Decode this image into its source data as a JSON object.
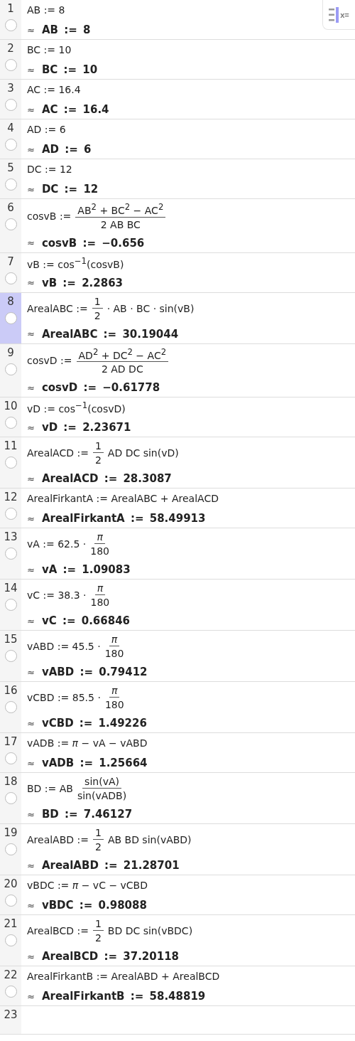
{
  "toggle": {
    "label": "x="
  },
  "rows": [
    {
      "number": "1",
      "selected": false,
      "input": [
        {
          "kind": "text",
          "text": "AB := 8"
        }
      ],
      "approx": "≈",
      "output": "AB := 8"
    },
    {
      "number": "2",
      "selected": false,
      "input": [
        {
          "kind": "text",
          "text": "BC := 10"
        }
      ],
      "approx": "≈",
      "output": "BC := 10"
    },
    {
      "number": "3",
      "selected": false,
      "input": [
        {
          "kind": "text",
          "text": "AC := 16.4"
        }
      ],
      "approx": "≈",
      "output": "AC := 16.4"
    },
    {
      "number": "4",
      "selected": false,
      "input": [
        {
          "kind": "text",
          "text": "AD := 6"
        }
      ],
      "approx": "≈",
      "output": "AD := 6"
    },
    {
      "number": "5",
      "selected": false,
      "input": [
        {
          "kind": "text",
          "text": "DC := 12"
        }
      ],
      "approx": "≈",
      "output": "DC := 12"
    },
    {
      "number": "6",
      "selected": false,
      "input": [
        {
          "kind": "text",
          "text": "cosvB :="
        },
        {
          "kind": "frac",
          "num": "AB$^{2}$ + BC$^{2}$ − AC$^{2}$",
          "den": "2 AB BC"
        }
      ],
      "approx": "≈",
      "output": "cosvB := −0.656"
    },
    {
      "number": "7",
      "selected": false,
      "input": [
        {
          "kind": "text",
          "text": "vB := cos$^{−1}$(cosvB)"
        }
      ],
      "approx": "≈",
      "output": "vB := 2.2863"
    },
    {
      "number": "8",
      "selected": true,
      "input": [
        {
          "kind": "text",
          "text": "ArealABC :="
        },
        {
          "kind": "frac",
          "num": "1",
          "den": "2"
        },
        {
          "kind": "text",
          "text": "·  AB  ·  BC  ·  sin(vB)"
        }
      ],
      "approx": "≈",
      "output": "ArealABC := 30.19044"
    },
    {
      "number": "9",
      "selected": false,
      "input": [
        {
          "kind": "text",
          "text": "cosvD :="
        },
        {
          "kind": "frac",
          "num": "AD$^{2}$ + DC$^{2}$ − AC$^{2}$",
          "den": "2 AD DC"
        }
      ],
      "approx": "≈",
      "output": "cosvD := −0.61778"
    },
    {
      "number": "10",
      "selected": false,
      "input": [
        {
          "kind": "text",
          "text": "vD := cos$^{−1}$(cosvD)"
        }
      ],
      "approx": "≈",
      "output": "vD := 2.23671"
    },
    {
      "number": "11",
      "selected": false,
      "input": [
        {
          "kind": "text",
          "text": "ArealACD :="
        },
        {
          "kind": "frac",
          "num": "1",
          "den": "2"
        },
        {
          "kind": "text",
          "text": "AD DC  sin(vD)"
        }
      ],
      "approx": "≈",
      "output": "ArealACD := 28.3087"
    },
    {
      "number": "12",
      "selected": false,
      "input": [
        {
          "kind": "text",
          "text": "ArealFirkantA := ArealABC + ArealACD"
        }
      ],
      "approx": "≈",
      "output": "ArealFirkantA := 58.49913"
    },
    {
      "number": "13",
      "selected": false,
      "input": [
        {
          "kind": "text",
          "text": "vA := 62.5 ·"
        },
        {
          "kind": "frac",
          "num": "*π*",
          "den": "180"
        }
      ],
      "approx": "≈",
      "output": "vA := 1.09083"
    },
    {
      "number": "14",
      "selected": false,
      "input": [
        {
          "kind": "text",
          "text": "vC := 38.3 ·"
        },
        {
          "kind": "frac",
          "num": "*π*",
          "den": "180"
        }
      ],
      "approx": "≈",
      "output": "vC := 0.66846"
    },
    {
      "number": "15",
      "selected": false,
      "input": [
        {
          "kind": "text",
          "text": "vABD := 45.5 ·"
        },
        {
          "kind": "frac",
          "num": "*π*",
          "den": "180"
        }
      ],
      "approx": "≈",
      "output": "vABD := 0.79412"
    },
    {
      "number": "16",
      "selected": false,
      "input": [
        {
          "kind": "text",
          "text": "vCBD := 85.5 ·"
        },
        {
          "kind": "frac",
          "num": "*π*",
          "den": "180"
        }
      ],
      "approx": "≈",
      "output": "vCBD := 1.49226"
    },
    {
      "number": "17",
      "selected": false,
      "input": [
        {
          "kind": "text",
          "text": "vADB := *π* − vA − vABD"
        }
      ],
      "approx": "≈",
      "output": "vADB := 1.25664"
    },
    {
      "number": "18",
      "selected": false,
      "input": [
        {
          "kind": "text",
          "text": "BD := AB"
        },
        {
          "kind": "frac",
          "num": "sin(vA)",
          "den": "sin(vADB)"
        }
      ],
      "approx": "≈",
      "output": "BD := 7.46127"
    },
    {
      "number": "19",
      "selected": false,
      "input": [
        {
          "kind": "text",
          "text": "ArealABD :="
        },
        {
          "kind": "frac",
          "num": "1",
          "den": "2"
        },
        {
          "kind": "text",
          "text": "AB BD  sin(vABD)"
        }
      ],
      "approx": "≈",
      "output": "ArealABD := 21.28701"
    },
    {
      "number": "20",
      "selected": false,
      "input": [
        {
          "kind": "text",
          "text": "vBDC := *π* − vC − vCBD"
        }
      ],
      "approx": "≈",
      "output": "vBDC := 0.98088"
    },
    {
      "number": "21",
      "selected": false,
      "input": [
        {
          "kind": "text",
          "text": "ArealBCD :="
        },
        {
          "kind": "frac",
          "num": "1",
          "den": "2"
        },
        {
          "kind": "text",
          "text": "BD DC  sin(vBDC)"
        }
      ],
      "approx": "≈",
      "output": "ArealBCD := 37.20118"
    },
    {
      "number": "22",
      "selected": false,
      "input": [
        {
          "kind": "text",
          "text": "ArealFirkantB := ArealABD + ArealBCD"
        }
      ],
      "approx": "≈",
      "output": "ArealFirkantB := 58.48819"
    },
    {
      "number": "23",
      "selected": false
    }
  ]
}
